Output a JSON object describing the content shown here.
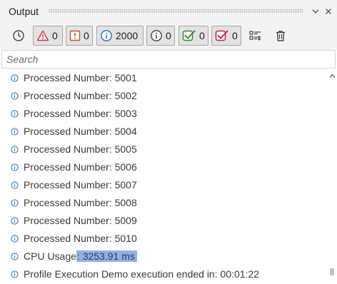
{
  "panel": {
    "title": "Output"
  },
  "toolbar": {
    "error_count": "0",
    "warning_count": "0",
    "info_count": "2000",
    "verbose_count": "0",
    "success_count": "0",
    "failure_count": "0"
  },
  "search": {
    "placeholder": "Search",
    "value": ""
  },
  "log": {
    "entries": [
      "Processed Number: 5001",
      "Processed Number: 5002",
      "Processed Number: 5003",
      "Processed Number: 5004",
      "Processed Number: 5005",
      "Processed Number: 5006",
      "Processed Number: 5007",
      "Processed Number: 5008",
      "Processed Number: 5009",
      "Processed Number: 5010"
    ],
    "cpu_label": "CPU Usage",
    "cpu_value": ": 3253.91 ms",
    "final_entry": "Profile Execution Demo execution ended in: 00:01:22"
  },
  "colors": {
    "error": "#d8333a",
    "warning": "#b85c1e",
    "info": "#1f6fcf",
    "success": "#2e8b2e",
    "failure": "#c8233a",
    "selection": "#8fb2e6"
  }
}
